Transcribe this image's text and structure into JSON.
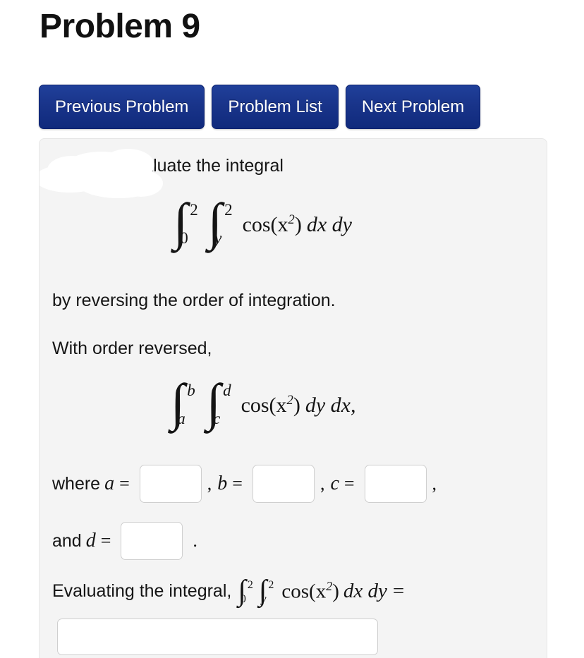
{
  "page": {
    "title": "Problem 9",
    "background_color": "#ffffff",
    "panel_background_color": "#f4f4f4"
  },
  "nav": {
    "buttons": [
      {
        "label": "Previous Problem",
        "name": "previous-problem-button"
      },
      {
        "label": "Problem List",
        "name": "problem-list-button"
      },
      {
        "label": "Next Problem",
        "name": "next-problem-button"
      }
    ],
    "button_color": "#19348a",
    "button_text_color": "#ffffff"
  },
  "problem": {
    "redacted_prefix": "",
    "prompt_line": "Evaluate the integral",
    "instruction_line": "by reversing the order of integration.",
    "reversed_label": "With order reversed,",
    "integral_original": {
      "outer_upper": "2",
      "outer_lower": "0",
      "inner_upper": "2",
      "inner_lower": "y",
      "integrand": "cos(x",
      "integrand_exponent": "2",
      "integrand_close": ")",
      "differentials": "dx dy"
    },
    "integral_reversed": {
      "outer_upper": "b",
      "outer_lower": "a",
      "inner_upper": "d",
      "inner_lower": "c",
      "integrand": "cos(x",
      "integrand_exponent": "2",
      "integrand_close": ")",
      "differentials": "dy dx,"
    },
    "where_label": "where",
    "and_label": "and",
    "symbol_a": "a",
    "symbol_b": "b",
    "symbol_c": "c",
    "symbol_d": "d",
    "equals": "=",
    "comma": ",",
    "period": ".",
    "evaluating_label": "Evaluating the integral,",
    "eval_integral": {
      "outer_upper": "2",
      "outer_lower": "0",
      "inner_upper": "2",
      "inner_lower": "y",
      "integrand": "cos(x",
      "integrand_exponent": "2",
      "integrand_close": ")",
      "differentials": "dx dy",
      "equals": "="
    },
    "answers": {
      "a_value": "",
      "a_placeholder": "",
      "b_value": "",
      "b_placeholder": "",
      "c_value": "",
      "c_placeholder": "",
      "d_value": "",
      "d_placeholder": "",
      "result_value": "",
      "result_placeholder": ""
    }
  }
}
